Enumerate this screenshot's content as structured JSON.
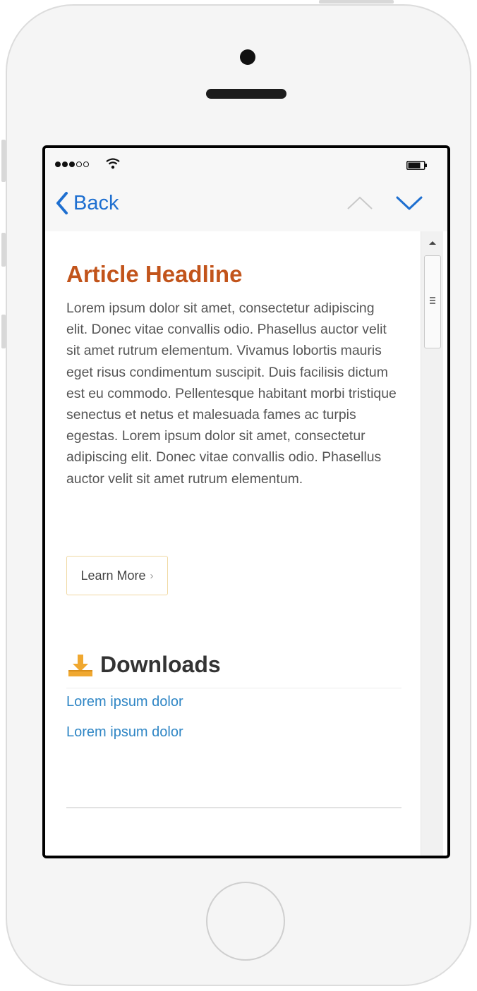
{
  "status_bar": {
    "signal_bars_filled": 3,
    "signal_bars_total": 5,
    "wifi_icon": "wifi-icon",
    "battery_icon": "battery-icon"
  },
  "nav": {
    "back_label": "Back",
    "back_icon": "chevron-left-icon",
    "up_icon": "chevron-up-icon",
    "down_icon": "chevron-down-icon",
    "accent_color": "#1e6fd0"
  },
  "article": {
    "headline": "Article Headline",
    "headline_color": "#c2541b",
    "body": "Lorem ipsum dolor sit amet, consectetur adipiscing elit. Donec vitae convallis odio. Phasellus auctor velit sit amet rutrum elementum. Vivamus lobortis mauris eget risus condimentum suscipit. Duis facilisis dictum est eu commodo. Pellentesque habitant morbi tristique senectus et netus et malesuada fames ac turpis egestas. Lorem ipsum dolor sit amet, consectetur adipiscing elit. Donec vitae convallis odio. Phasellus auctor velit sit amet rutrum elementum.",
    "learn_more_label": "Learn More",
    "learn_more_chevron": "›"
  },
  "downloads": {
    "title": "Downloads",
    "icon": "download-icon",
    "icon_color": "#f0a830",
    "links": [
      "Lorem ipsum dolor",
      "Lorem ipsum dolor"
    ],
    "link_color": "#2f86c5"
  },
  "scrollbar": {
    "up_icon": "scroll-up-arrow-icon"
  }
}
